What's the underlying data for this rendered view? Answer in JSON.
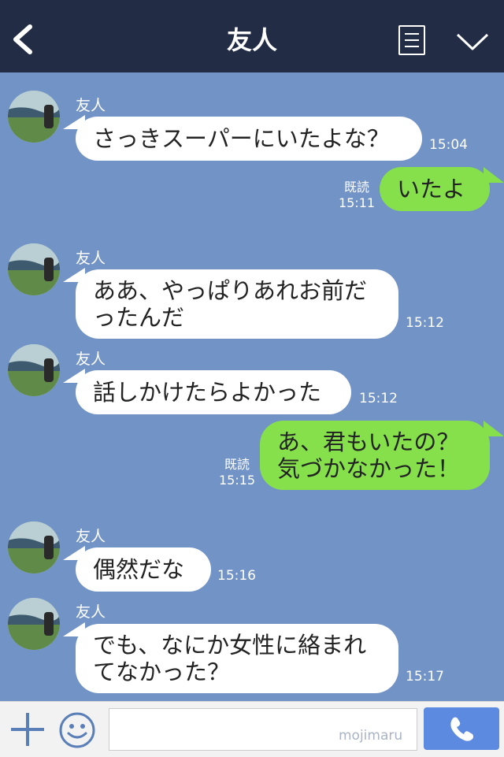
{
  "header": {
    "title": "友人",
    "back_icon": "chevron-left-icon",
    "menu_icon": "note-icon",
    "expand_icon": "chevron-down-icon"
  },
  "messages": [
    {
      "type": "in",
      "sender": "友人",
      "lines": [
        "さっきスーパーにいたよな？"
      ],
      "time": "15:04"
    },
    {
      "type": "out",
      "lines": [
        "いたよ"
      ],
      "read": "既読",
      "time": "15:11"
    },
    {
      "type": "in",
      "sender": "友人",
      "lines": [
        "ああ、やっぱりあれお前だ",
        "ったんだ"
      ],
      "time": "15:12"
    },
    {
      "type": "in",
      "sender": "友人",
      "lines": [
        "話しかけたらよかった"
      ],
      "time": "15:12"
    },
    {
      "type": "out",
      "lines": [
        "あ、君もいたの？",
        "気づかなかった！"
      ],
      "read": "既読",
      "time": "15:15"
    },
    {
      "type": "in",
      "sender": "友人",
      "lines": [
        "偶然だな"
      ],
      "time": "15:16"
    },
    {
      "type": "in",
      "sender": "友人",
      "lines": [
        "でも、なにか女性に絡まれ",
        "てなかった？"
      ],
      "time": "15:17"
    }
  ],
  "footer": {
    "input_value": "",
    "watermark": "mojimaru",
    "add_icon": "plus-icon",
    "sticker_icon": "smiley-icon",
    "send_icon": "phone-icon"
  },
  "colors": {
    "header": "#232c45",
    "chat_bg": "#7293c6",
    "bubble_out": "#86e04c",
    "bubble_in": "#ffffff",
    "send": "#5b8ae0"
  }
}
